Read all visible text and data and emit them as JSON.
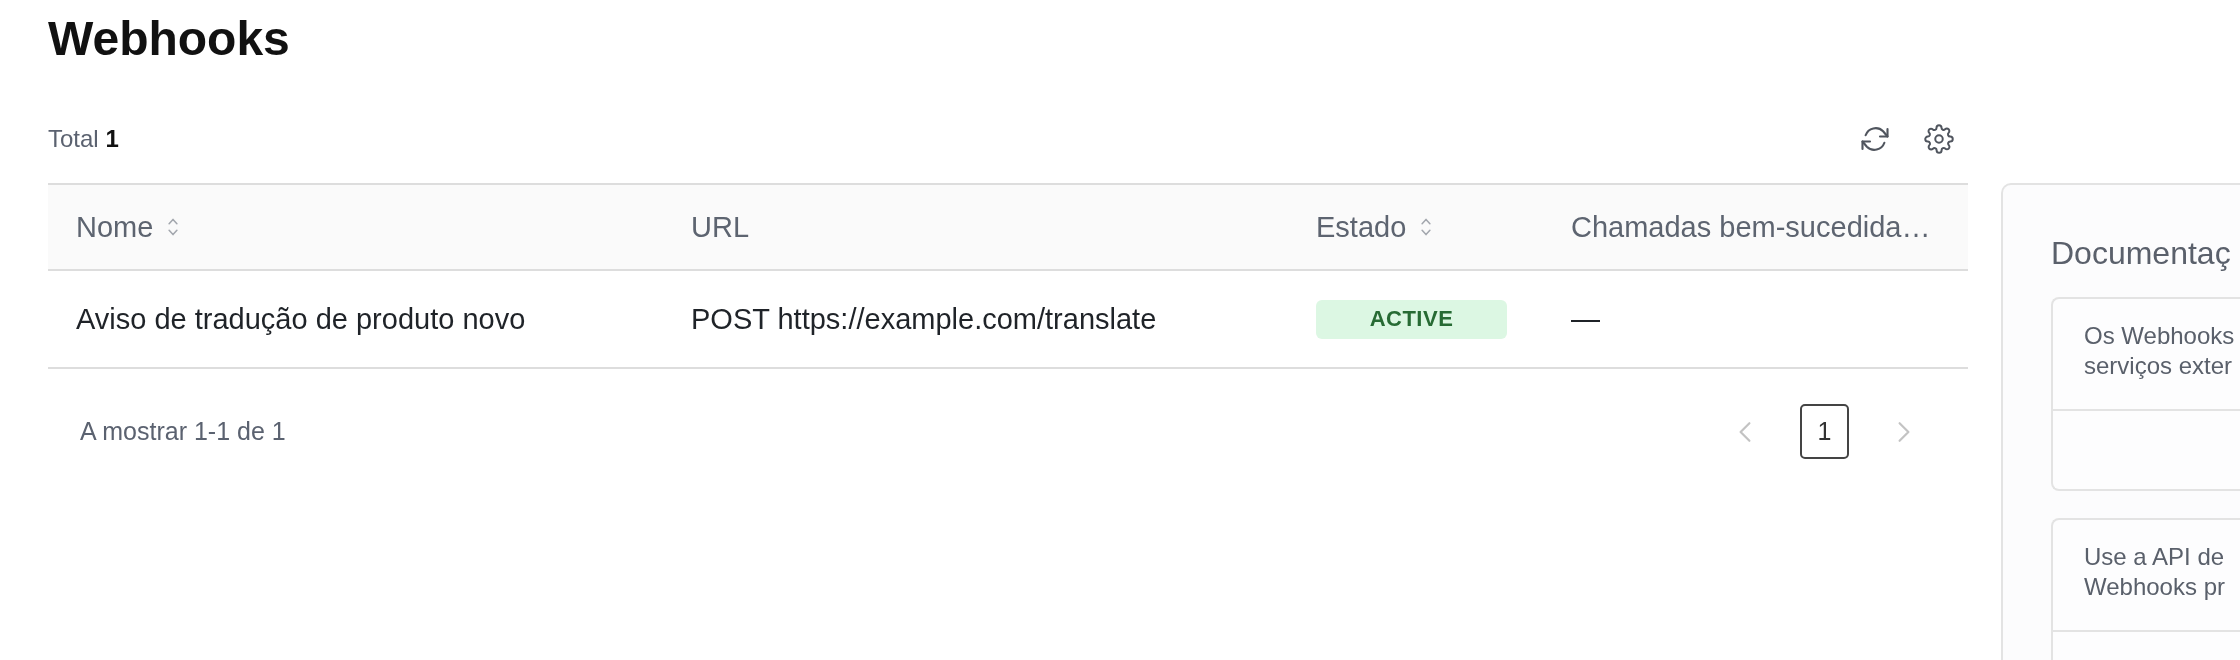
{
  "page": {
    "title": "Webhooks"
  },
  "toolbar": {
    "total": "Total **1**"
  },
  "table": {
    "columns": [
      {
        "label": "Nome",
        "sortable": true
      },
      {
        "label": "URL",
        "sortable": false
      },
      {
        "label": "Estado",
        "sortable": true
      },
      {
        "label": "Chamadas bem-sucedida…",
        "sortable": false
      }
    ],
    "rows": [
      {
        "cells": [
          {
            "kind": "text",
            "text": "Aviso de tradução de produto novo"
          },
          {
            "kind": "text",
            "text": "POST https://example.com/translate"
          },
          {
            "kind": "status",
            "text": "ACTIVE"
          },
          {
            "kind": "text",
            "text": "—"
          }
        ]
      }
    ]
  },
  "pagination": {
    "summary": "A mostrar 1-1 de 1",
    "previous": {
      "disabled": true
    },
    "pages": [
      {
        "label": "1",
        "selected": true
      }
    ],
    "next": {
      "disabled": true
    }
  },
  "documentation_panel": {
    "title": "Documentaç",
    "cards": [
      {
        "lines": [
          "Os Webhooks",
          "serviços exter"
        ]
      },
      {
        "lines": [
          "Use a API de",
          "Webhooks pr"
        ]
      }
    ]
  }
}
